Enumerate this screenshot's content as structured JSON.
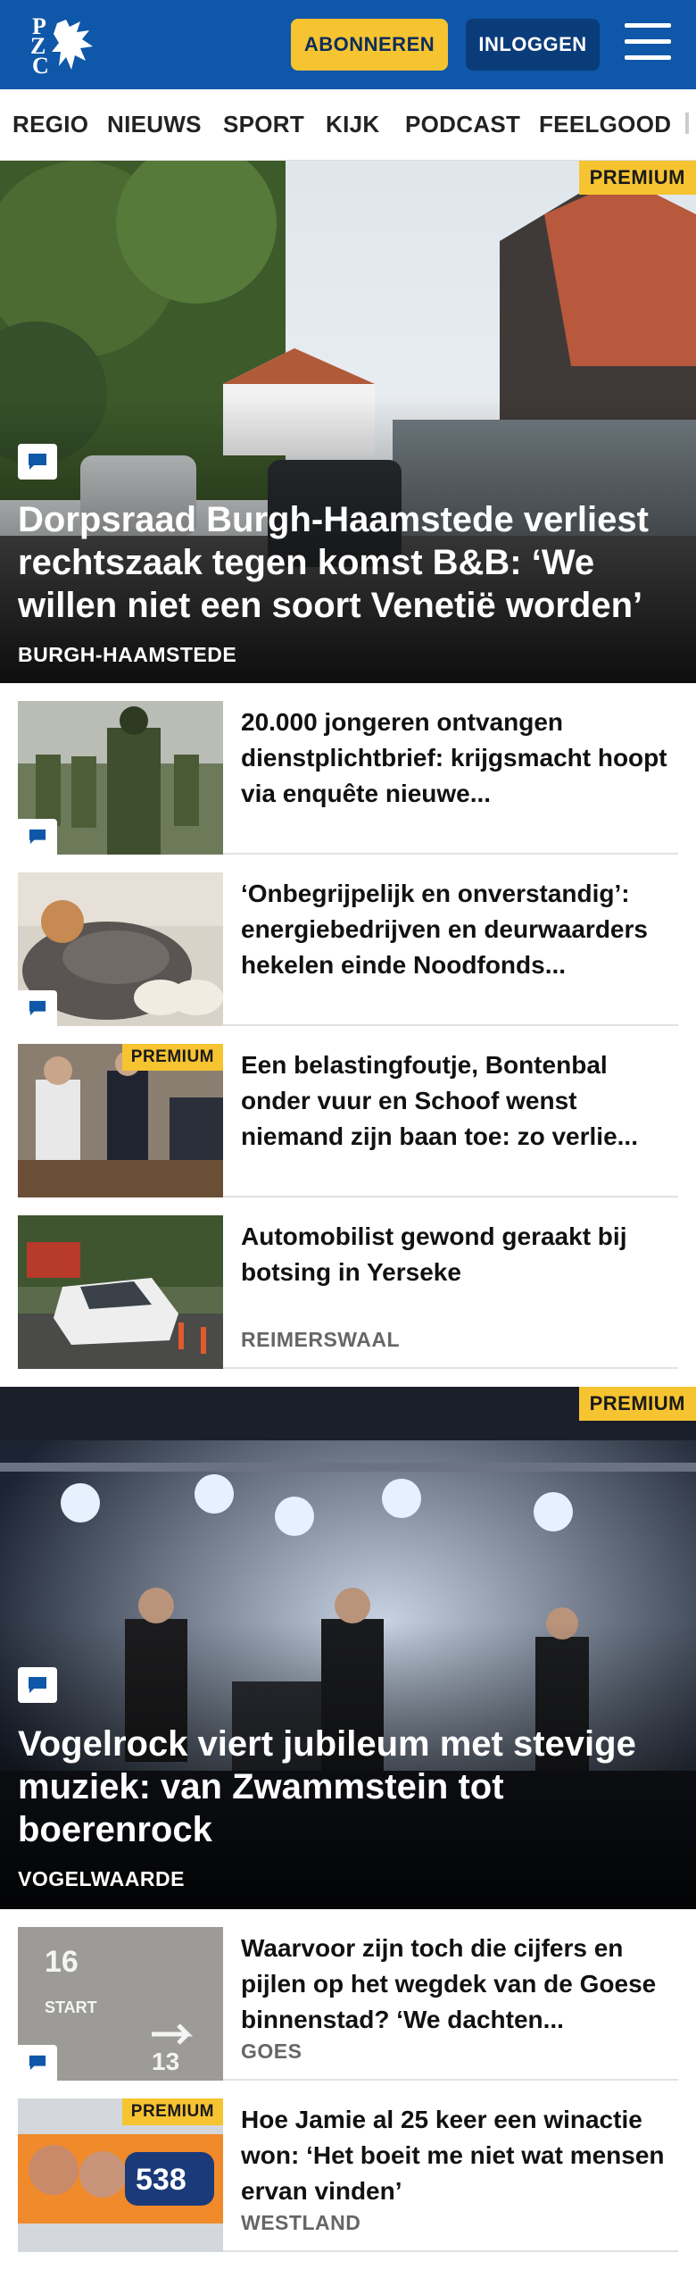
{
  "header": {
    "logo_text": "PZC",
    "subscribe_label": "ABONNEREN",
    "login_label": "INLOGGEN"
  },
  "nav": {
    "items": [
      "REGIO",
      "NIEUWS",
      "SPORT",
      "KIJK",
      "PODCAST",
      "FEELGOOD"
    ]
  },
  "premium_label": "PREMIUM",
  "hero1": {
    "title": "Dorpsraad Burgh-Haamstede verliest rechtszaak tegen komst B&B: ‘We willen niet een soort Venetië worden’",
    "location": "BURGH-HAAMSTEDE",
    "premium": true
  },
  "articles1": [
    {
      "title": "20.000 jongeren ontvangen dienstplichtbrief: krijgsmacht hoopt via enquête nieuwe...",
      "location": "",
      "premium": false,
      "comments": true
    },
    {
      "title": "‘Onbegrijpelijk en onverstandig’: energiebedrijven en deurwaar­ders hekelen einde Noodfonds...",
      "location": "",
      "premium": false,
      "comments": true
    },
    {
      "title": "Een belastingfoutje, Bontenbal onder vuur en Schoof wenst niemand zijn baan toe: zo verlie...",
      "location": "",
      "premium": true,
      "comments": false
    },
    {
      "title": "Automobilist gewond geraakt bij botsing in Yerseke",
      "location": "REIMERSWAAL",
      "premium": false,
      "comments": false
    }
  ],
  "hero2": {
    "title": "Vogelrock viert jubileum met stevige muziek: van Zwammstein tot boerenrock",
    "location": "VOGELWAARDE",
    "premium": true
  },
  "articles2": [
    {
      "title": "Waarvoor zijn toch die cijfers en pijlen op het wegdek van de Goese binnenstad? ‘We dachten...",
      "location": "GOES",
      "premium": false,
      "comments": true
    },
    {
      "title": "Hoe Jamie al 25 keer een winactie won: ‘Het boeit me niet wat mensen ervan vinden’",
      "location": "WESTLAND",
      "premium": true,
      "comments": false
    }
  ],
  "colors": {
    "brand_blue": "#0f57a8",
    "premium_yellow": "#f6c331",
    "login_navy": "#0b3c7a"
  }
}
